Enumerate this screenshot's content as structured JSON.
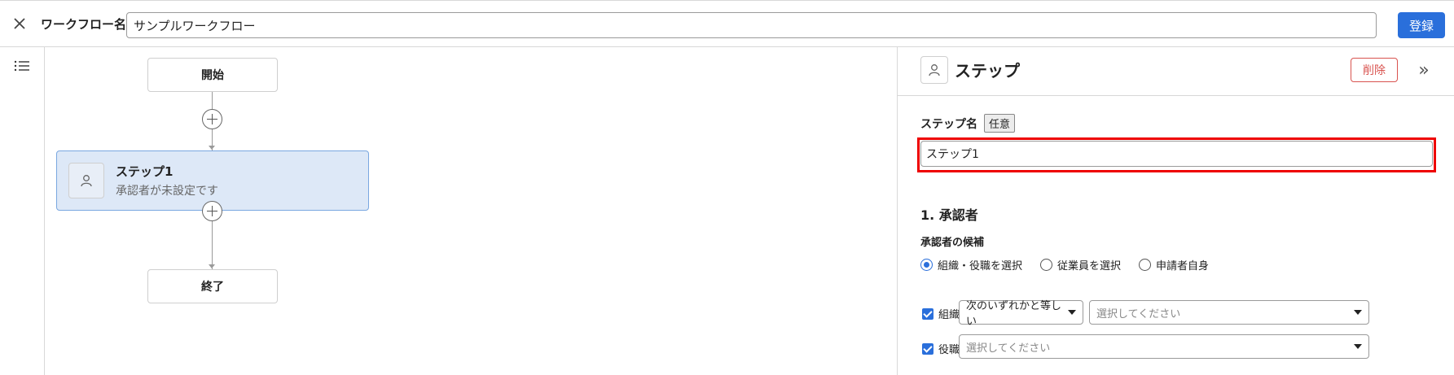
{
  "header": {
    "workflow_name_label": "ワークフロー名",
    "workflow_name_value": "サンプルワークフロー",
    "register_label": "登録"
  },
  "flow": {
    "start_label": "開始",
    "end_label": "終了",
    "step": {
      "title": "ステップ1",
      "subtitle": "承認者が未設定です"
    }
  },
  "panel": {
    "title": "ステップ",
    "delete_label": "削除",
    "collapse_glyph": "»",
    "step_name_label": "ステップ名",
    "optional_badge": "任意",
    "step_name_value": "ステップ1",
    "approver_section_title": "1. 承認者",
    "candidates_label": "承認者の候補",
    "radio_options": [
      {
        "label": "組織・役職を選択",
        "selected": true
      },
      {
        "label": "従業員を選択",
        "selected": false
      },
      {
        "label": "申請者自身",
        "selected": false
      }
    ],
    "org": {
      "label": "組織",
      "checked": true,
      "condition_value": "次のいずれかと等しい",
      "select_placeholder": "選択してください"
    },
    "role": {
      "label": "役職",
      "checked": true,
      "select_placeholder": "選択してください"
    }
  },
  "colors": {
    "accent": "#2a6fdb",
    "danger": "#d9534f",
    "step_fill": "#dde8f7",
    "highlight": "#e00000"
  }
}
